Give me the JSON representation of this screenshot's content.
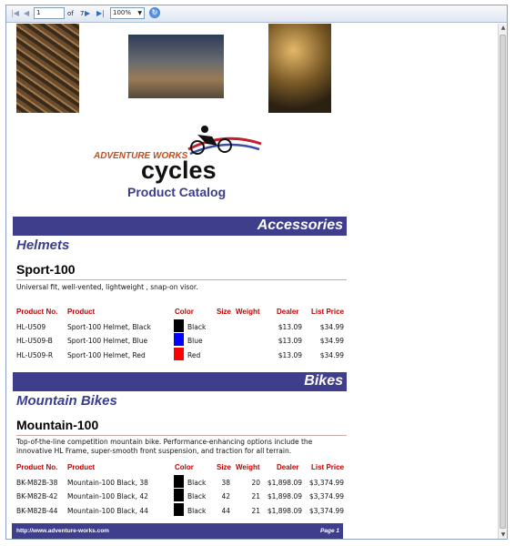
{
  "toolbar": {
    "first_icon": "first-page-icon",
    "prev_icon": "previous-page-icon",
    "page_value": "1",
    "of_label": "of",
    "page_total": "7",
    "next_icon": "next-page-icon",
    "last_icon": "last-page-icon",
    "zoom_value": "100%",
    "refresh_icon": "refresh-icon"
  },
  "report": {
    "logo_text_adventure": "ADVENTURE WORKS",
    "logo_text_cycles": "cycles",
    "title": "Product Catalog"
  },
  "columns": {
    "product_no": "Product No.",
    "product": "Product",
    "color": "Color",
    "size": "Size",
    "weight": "Weight",
    "dealer": "Dealer",
    "list_price": "List Price"
  },
  "sections": [
    {
      "category": "Accessories",
      "subcategory": "Helmets",
      "model": "Sport-100",
      "description": "Universal fit, well-vented, lightweight , snap-on visor.",
      "rows": [
        {
          "no": "HL-U509",
          "name": "Sport-100 Helmet, Black",
          "color": "Black",
          "swatch": "#000000",
          "size": "",
          "weight": "",
          "dealer": "$13.09",
          "list": "$34.99"
        },
        {
          "no": "HL-U509-B",
          "name": "Sport-100 Helmet, Blue",
          "color": "Blue",
          "swatch": "#0000ff",
          "size": "",
          "weight": "",
          "dealer": "$13.09",
          "list": "$34.99"
        },
        {
          "no": "HL-U509-R",
          "name": "Sport-100 Helmet, Red",
          "color": "Red",
          "swatch": "#ff0000",
          "size": "",
          "weight": "",
          "dealer": "$13.09",
          "list": "$34.99"
        }
      ]
    },
    {
      "category": "Bikes",
      "subcategory": "Mountain Bikes",
      "model": "Mountain-100",
      "description": "Top-of-the-line competition mountain bike. Performance-enhancing options include the innovative HL Frame, super-smooth front suspension, and traction for all terrain.",
      "rows": [
        {
          "no": "BK-M82B-38",
          "name": "Mountain-100 Black, 38",
          "color": "Black",
          "swatch": "#000000",
          "size": "38",
          "weight": "20",
          "dealer": "$1,898.09",
          "list": "$3,374.99"
        },
        {
          "no": "BK-M82B-42",
          "name": "Mountain-100 Black, 42",
          "color": "Black",
          "swatch": "#000000",
          "size": "42",
          "weight": "21",
          "dealer": "$1,898.09",
          "list": "$3,374.99"
        },
        {
          "no": "BK-M82B-44",
          "name": "Mountain-100 Black, 44",
          "color": "Black",
          "swatch": "#000000",
          "size": "44",
          "weight": "21",
          "dealer": "$1,898.09",
          "list": "$3,374.99"
        }
      ]
    }
  ],
  "footer": {
    "url": "http://www.adventure-works.com",
    "page": "Page 1"
  },
  "colors": {
    "band": "#3f3e8c",
    "header_text": "#c00000",
    "accent": "#3b3e8f"
  }
}
